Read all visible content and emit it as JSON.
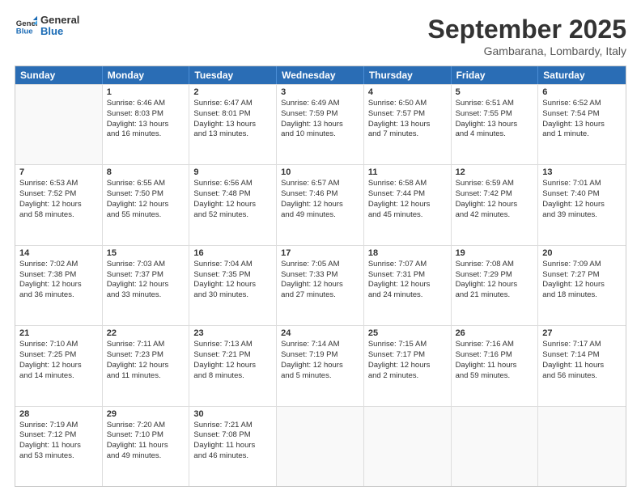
{
  "header": {
    "logo_general": "General",
    "logo_blue": "Blue",
    "month_title": "September 2025",
    "location": "Gambarana, Lombardy, Italy"
  },
  "days_of_week": [
    "Sunday",
    "Monday",
    "Tuesday",
    "Wednesday",
    "Thursday",
    "Friday",
    "Saturday"
  ],
  "weeks": [
    [
      {
        "day": null,
        "data": null
      },
      {
        "day": "1",
        "data": [
          "Sunrise: 6:46 AM",
          "Sunset: 8:03 PM",
          "Daylight: 13 hours",
          "and 16 minutes."
        ]
      },
      {
        "day": "2",
        "data": [
          "Sunrise: 6:47 AM",
          "Sunset: 8:01 PM",
          "Daylight: 13 hours",
          "and 13 minutes."
        ]
      },
      {
        "day": "3",
        "data": [
          "Sunrise: 6:49 AM",
          "Sunset: 7:59 PM",
          "Daylight: 13 hours",
          "and 10 minutes."
        ]
      },
      {
        "day": "4",
        "data": [
          "Sunrise: 6:50 AM",
          "Sunset: 7:57 PM",
          "Daylight: 13 hours",
          "and 7 minutes."
        ]
      },
      {
        "day": "5",
        "data": [
          "Sunrise: 6:51 AM",
          "Sunset: 7:55 PM",
          "Daylight: 13 hours",
          "and 4 minutes."
        ]
      },
      {
        "day": "6",
        "data": [
          "Sunrise: 6:52 AM",
          "Sunset: 7:54 PM",
          "Daylight: 13 hours",
          "and 1 minute."
        ]
      }
    ],
    [
      {
        "day": "7",
        "data": [
          "Sunrise: 6:53 AM",
          "Sunset: 7:52 PM",
          "Daylight: 12 hours",
          "and 58 minutes."
        ]
      },
      {
        "day": "8",
        "data": [
          "Sunrise: 6:55 AM",
          "Sunset: 7:50 PM",
          "Daylight: 12 hours",
          "and 55 minutes."
        ]
      },
      {
        "day": "9",
        "data": [
          "Sunrise: 6:56 AM",
          "Sunset: 7:48 PM",
          "Daylight: 12 hours",
          "and 52 minutes."
        ]
      },
      {
        "day": "10",
        "data": [
          "Sunrise: 6:57 AM",
          "Sunset: 7:46 PM",
          "Daylight: 12 hours",
          "and 49 minutes."
        ]
      },
      {
        "day": "11",
        "data": [
          "Sunrise: 6:58 AM",
          "Sunset: 7:44 PM",
          "Daylight: 12 hours",
          "and 45 minutes."
        ]
      },
      {
        "day": "12",
        "data": [
          "Sunrise: 6:59 AM",
          "Sunset: 7:42 PM",
          "Daylight: 12 hours",
          "and 42 minutes."
        ]
      },
      {
        "day": "13",
        "data": [
          "Sunrise: 7:01 AM",
          "Sunset: 7:40 PM",
          "Daylight: 12 hours",
          "and 39 minutes."
        ]
      }
    ],
    [
      {
        "day": "14",
        "data": [
          "Sunrise: 7:02 AM",
          "Sunset: 7:38 PM",
          "Daylight: 12 hours",
          "and 36 minutes."
        ]
      },
      {
        "day": "15",
        "data": [
          "Sunrise: 7:03 AM",
          "Sunset: 7:37 PM",
          "Daylight: 12 hours",
          "and 33 minutes."
        ]
      },
      {
        "day": "16",
        "data": [
          "Sunrise: 7:04 AM",
          "Sunset: 7:35 PM",
          "Daylight: 12 hours",
          "and 30 minutes."
        ]
      },
      {
        "day": "17",
        "data": [
          "Sunrise: 7:05 AM",
          "Sunset: 7:33 PM",
          "Daylight: 12 hours",
          "and 27 minutes."
        ]
      },
      {
        "day": "18",
        "data": [
          "Sunrise: 7:07 AM",
          "Sunset: 7:31 PM",
          "Daylight: 12 hours",
          "and 24 minutes."
        ]
      },
      {
        "day": "19",
        "data": [
          "Sunrise: 7:08 AM",
          "Sunset: 7:29 PM",
          "Daylight: 12 hours",
          "and 21 minutes."
        ]
      },
      {
        "day": "20",
        "data": [
          "Sunrise: 7:09 AM",
          "Sunset: 7:27 PM",
          "Daylight: 12 hours",
          "and 18 minutes."
        ]
      }
    ],
    [
      {
        "day": "21",
        "data": [
          "Sunrise: 7:10 AM",
          "Sunset: 7:25 PM",
          "Daylight: 12 hours",
          "and 14 minutes."
        ]
      },
      {
        "day": "22",
        "data": [
          "Sunrise: 7:11 AM",
          "Sunset: 7:23 PM",
          "Daylight: 12 hours",
          "and 11 minutes."
        ]
      },
      {
        "day": "23",
        "data": [
          "Sunrise: 7:13 AM",
          "Sunset: 7:21 PM",
          "Daylight: 12 hours",
          "and 8 minutes."
        ]
      },
      {
        "day": "24",
        "data": [
          "Sunrise: 7:14 AM",
          "Sunset: 7:19 PM",
          "Daylight: 12 hours",
          "and 5 minutes."
        ]
      },
      {
        "day": "25",
        "data": [
          "Sunrise: 7:15 AM",
          "Sunset: 7:17 PM",
          "Daylight: 12 hours",
          "and 2 minutes."
        ]
      },
      {
        "day": "26",
        "data": [
          "Sunrise: 7:16 AM",
          "Sunset: 7:16 PM",
          "Daylight: 11 hours",
          "and 59 minutes."
        ]
      },
      {
        "day": "27",
        "data": [
          "Sunrise: 7:17 AM",
          "Sunset: 7:14 PM",
          "Daylight: 11 hours",
          "and 56 minutes."
        ]
      }
    ],
    [
      {
        "day": "28",
        "data": [
          "Sunrise: 7:19 AM",
          "Sunset: 7:12 PM",
          "Daylight: 11 hours",
          "and 53 minutes."
        ]
      },
      {
        "day": "29",
        "data": [
          "Sunrise: 7:20 AM",
          "Sunset: 7:10 PM",
          "Daylight: 11 hours",
          "and 49 minutes."
        ]
      },
      {
        "day": "30",
        "data": [
          "Sunrise: 7:21 AM",
          "Sunset: 7:08 PM",
          "Daylight: 11 hours",
          "and 46 minutes."
        ]
      },
      {
        "day": null,
        "data": null
      },
      {
        "day": null,
        "data": null
      },
      {
        "day": null,
        "data": null
      },
      {
        "day": null,
        "data": null
      }
    ]
  ]
}
